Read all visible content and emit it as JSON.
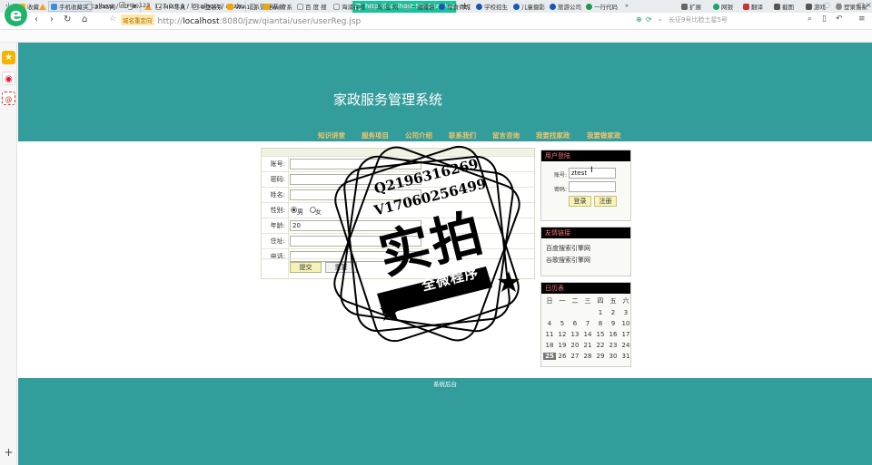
{
  "browser": {
    "tabs": [
      {
        "label": "127.0.0.1 / localhost / db_jz..."
      },
      {
        "label": "127.0.0.1 / localhost / anzhua..."
      },
      {
        "label": "管理系统"
      },
      {
        "label": "http://localhost:8080/jzw/qia..."
      }
    ],
    "url_badge": "域名重定向",
    "url_prefix": "http://",
    "url_host": "localhost",
    "url_rest": ":8080/jzw/qiantai/user/userReg.jsp",
    "search_placeholder": "长征9号比脸土星5号",
    "bookmarks": [
      {
        "label": "收藏"
      },
      {
        "label": "手机收藏夹"
      },
      {
        "label": "2345网"
      },
      {
        "label": "Hao123"
      },
      {
        "label": "MM写真"
      },
      {
        "label": "U盘装系"
      },
      {
        "label": "Win10系"
      },
      {
        "label": "Win7系"
      },
      {
        "label": "百 度 搜"
      },
      {
        "label": "海涌在线"
      },
      {
        "label": "淘 宝 网"
      },
      {
        "label": "一键重装"
      },
      {
        "label": "零食商城"
      },
      {
        "label": "学校招生"
      },
      {
        "label": "儿童摄影"
      },
      {
        "label": "旅游公司"
      },
      {
        "label": "一行代码"
      }
    ],
    "toolbar_right": [
      {
        "label": "扩展"
      },
      {
        "label": "网银"
      },
      {
        "label": "翻译"
      },
      {
        "label": "截图"
      },
      {
        "label": "游戏"
      },
      {
        "label": "登录管家"
      }
    ]
  },
  "site": {
    "title": "家政服务管理系统",
    "nav": [
      {
        "label": "知识讲堂"
      },
      {
        "label": "服务项目"
      },
      {
        "label": "公司介绍"
      },
      {
        "label": "联系我们"
      },
      {
        "label": "留言咨询"
      },
      {
        "label": "我要找家政"
      },
      {
        "label": "我要做家政"
      }
    ],
    "footer_link": "系统后台"
  },
  "regform": {
    "account_label": "账号:",
    "password_label": "密码:",
    "name_label": "姓名:",
    "gender_label": "性别:",
    "gender_male": "男",
    "gender_female": "女",
    "gender_selected": "男",
    "age_label": "年龄:",
    "age_value": "20",
    "address_label": "住址:",
    "phone_label": "电话:",
    "submit_label": "提交",
    "reset_label": "重置"
  },
  "login": {
    "title": "用户登陆",
    "account_label": "账号:",
    "account_value": "ztest",
    "password_label": "密码:",
    "login_label": "登录",
    "register_label": "注册"
  },
  "links": {
    "title": "友情链接",
    "items": [
      {
        "label": "百度搜索引擎网"
      },
      {
        "label": "谷歌搜索引擎网"
      }
    ]
  },
  "calendar": {
    "title": "日历表",
    "weekdays": [
      "日",
      "一",
      "二",
      "三",
      "四",
      "五",
      "六"
    ],
    "weeks": [
      [
        "",
        "",
        "",
        "",
        "1",
        "2",
        "3"
      ],
      [
        "4",
        "5",
        "6",
        "7",
        "8",
        "9",
        "10"
      ],
      [
        "11",
        "12",
        "13",
        "14",
        "15",
        "16",
        "17"
      ],
      [
        "18",
        "19",
        "20",
        "21",
        "22",
        "23",
        "24"
      ],
      [
        "25",
        "26",
        "27",
        "28",
        "29",
        "30",
        "31"
      ]
    ],
    "today": "25"
  },
  "watermark": {
    "line1": "Q2196316269",
    "line2": "V17060256499",
    "big": "实拍",
    "small": "全微程序"
  }
}
